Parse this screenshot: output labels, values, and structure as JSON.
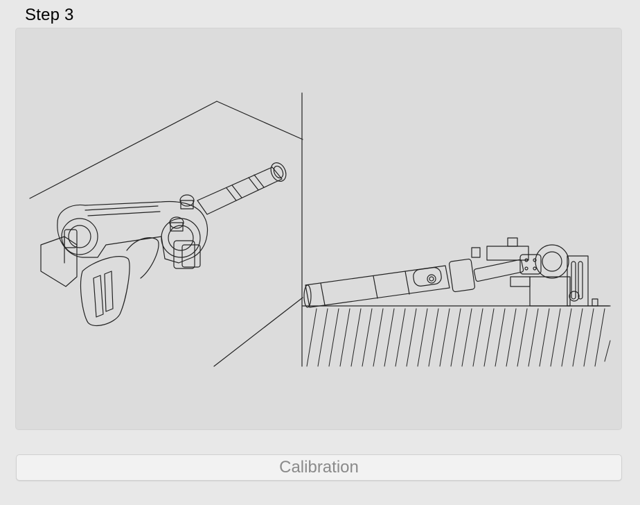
{
  "step": {
    "title": "Step 3"
  },
  "illustration": {
    "description_icon": "gimbal-calibration-icon",
    "left_view": "gimbal-on-table-corner-icon",
    "right_view": "gimbal-lying-on-floor-icon"
  },
  "actions": {
    "calibration_label": "Calibration",
    "calibration_enabled": false
  },
  "colors": {
    "window_bg": "#e8e8e8",
    "panel_bg": "#dcdcdc",
    "button_bg": "#f2f2f2",
    "button_text_disabled": "#8a8a8a",
    "line_art": "#222222"
  }
}
